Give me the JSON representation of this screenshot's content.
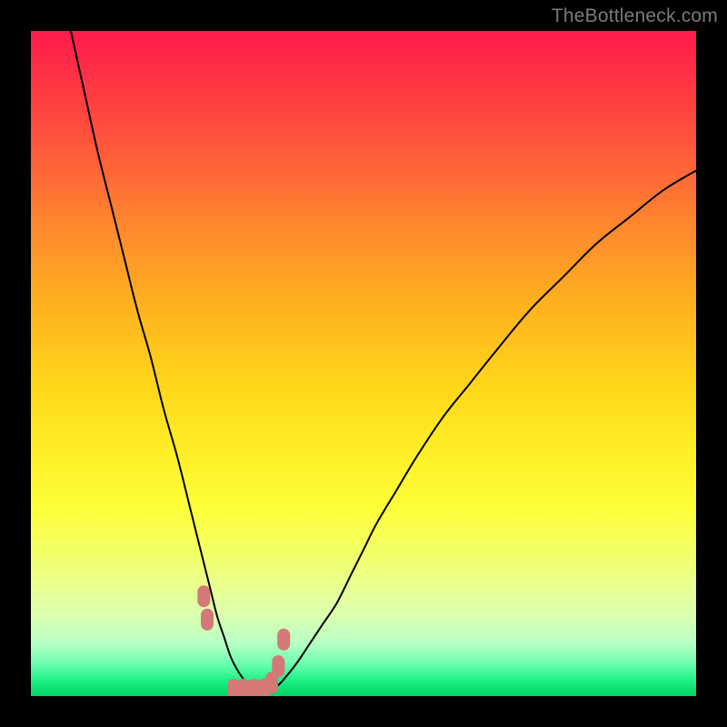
{
  "watermark": "TheBottleneck.com",
  "colors": {
    "frame": "#000000",
    "curve": "#000000",
    "marker": "#d47878",
    "gradient_top": "#ff1a4a",
    "gradient_bottom": "#06d466"
  },
  "chart_data": {
    "type": "line",
    "title": "",
    "xlabel": "",
    "ylabel": "",
    "xlim": [
      0,
      100
    ],
    "ylim": [
      0,
      100
    ],
    "grid": false,
    "series": [
      {
        "name": "bottleneck-curve",
        "x": [
          6,
          8,
          10,
          12,
          14,
          16,
          18,
          20,
          22,
          24,
          25,
          26,
          27,
          28,
          29,
          30,
          31,
          32,
          33,
          34,
          35,
          36,
          37,
          38,
          40,
          42,
          44,
          46,
          48,
          50,
          52,
          55,
          58,
          62,
          66,
          70,
          75,
          80,
          85,
          90,
          95,
          100
        ],
        "values": [
          100,
          91,
          82,
          74,
          66,
          58,
          51,
          43,
          36,
          28,
          24,
          20,
          16,
          12,
          9,
          6,
          4,
          2.5,
          1.5,
          1,
          1,
          1,
          1.5,
          2.5,
          5,
          8,
          11,
          14,
          18,
          22,
          26,
          31,
          36,
          42,
          47,
          52,
          58,
          63,
          68,
          72,
          76,
          79
        ]
      }
    ],
    "markers": {
      "name": "highlighted-points",
      "x": [
        26.0,
        26.5,
        30.5,
        32.0,
        33.5,
        35.0,
        36.2,
        37.2,
        38.0
      ],
      "values": [
        15.0,
        11.5,
        1.0,
        1.0,
        1.0,
        1.0,
        2.0,
        4.5,
        8.5
      ]
    }
  }
}
